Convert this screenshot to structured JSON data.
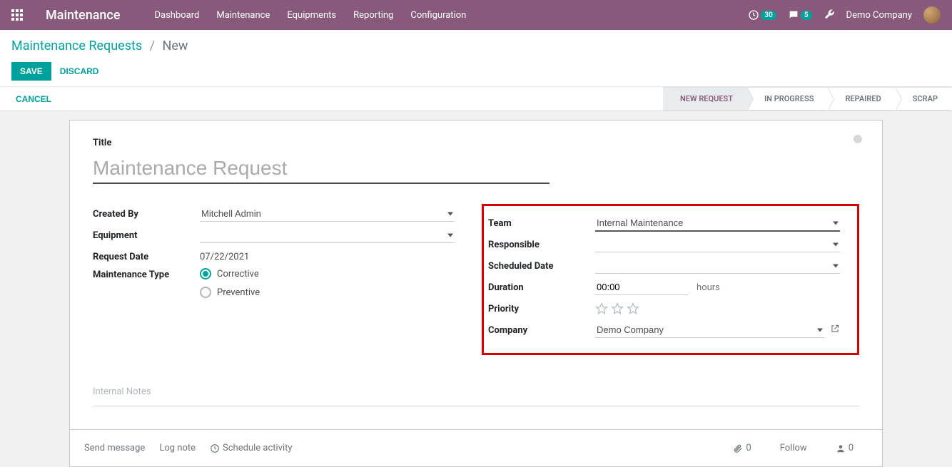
{
  "navbar": {
    "brand": "Maintenance",
    "links": [
      "Dashboard",
      "Maintenance",
      "Equipments",
      "Reporting",
      "Configuration"
    ],
    "activities_count": "30",
    "messages_count": "5",
    "company": "Demo Company"
  },
  "breadcrumb": {
    "parent": "Maintenance Requests",
    "current": "New"
  },
  "actions": {
    "save": "Save",
    "discard": "Discard",
    "cancel": "Cancel"
  },
  "status": {
    "steps": [
      "NEW REQUEST",
      "IN PROGRESS",
      "REPAIRED",
      "SCRAP"
    ],
    "active_index": 0
  },
  "form": {
    "title_label": "Title",
    "title_placeholder": "Maintenance Request",
    "left": {
      "created_by_label": "Created By",
      "created_by_value": "Mitchell Admin",
      "equipment_label": "Equipment",
      "equipment_value": "",
      "request_date_label": "Request Date",
      "request_date_value": "07/22/2021",
      "maint_type_label": "Maintenance Type",
      "maint_type_options": [
        "Corrective",
        "Preventive"
      ],
      "maint_type_selected": "Corrective"
    },
    "right": {
      "team_label": "Team",
      "team_value": "Internal Maintenance",
      "responsible_label": "Responsible",
      "responsible_value": "",
      "scheduled_label": "Scheduled Date",
      "scheduled_value": "",
      "duration_label": "Duration",
      "duration_value": "00:00",
      "duration_unit": "hours",
      "priority_label": "Priority",
      "company_label": "Company",
      "company_value": "Demo Company"
    },
    "notes_placeholder": "Internal Notes"
  },
  "chatter": {
    "send": "Send message",
    "log": "Log note",
    "schedule": "Schedule activity",
    "attach_count": "0",
    "follow": "Follow",
    "followers_count": "0"
  }
}
